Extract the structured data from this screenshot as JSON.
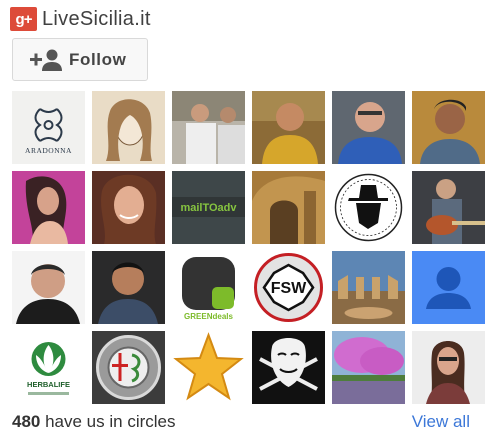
{
  "page": {
    "title": "LiveSicilia.it",
    "badge": "g+"
  },
  "follow": {
    "label": "Follow",
    "icon": "person-add-icon"
  },
  "avatars": [
    {
      "name": "avatar-aradonna",
      "label": "ARADONNA",
      "kind": "logo"
    },
    {
      "name": "avatar-illustration-woman",
      "kind": "photo"
    },
    {
      "name": "avatar-men-group",
      "kind": "photo"
    },
    {
      "name": "avatar-man-outdoor",
      "kind": "photo"
    },
    {
      "name": "avatar-man-blue-shirt",
      "kind": "photo"
    },
    {
      "name": "avatar-man-portrait",
      "kind": "photo"
    },
    {
      "name": "avatar-woman-pink",
      "kind": "photo"
    },
    {
      "name": "avatar-woman-smile",
      "kind": "photo"
    },
    {
      "name": "avatar-mailtoadv",
      "label": "mailTOadv",
      "kind": "logo"
    },
    {
      "name": "avatar-arch-building",
      "kind": "photo"
    },
    {
      "name": "avatar-hat-silhouette",
      "kind": "logo"
    },
    {
      "name": "avatar-guitarist",
      "kind": "photo"
    },
    {
      "name": "avatar-man-white-bg",
      "kind": "photo"
    },
    {
      "name": "avatar-man-dark",
      "kind": "photo"
    },
    {
      "name": "avatar-greendeals",
      "label": "GREENdeals",
      "kind": "logo"
    },
    {
      "name": "avatar-fsw",
      "label": "FSW",
      "kind": "logo"
    },
    {
      "name": "avatar-theatre",
      "kind": "photo"
    },
    {
      "name": "avatar-default-profile",
      "kind": "placeholder"
    },
    {
      "name": "avatar-herbalife",
      "label": "HERBALIFE",
      "kind": "logo"
    },
    {
      "name": "avatar-alfa-romeo",
      "kind": "logo"
    },
    {
      "name": "avatar-star",
      "kind": "logo"
    },
    {
      "name": "avatar-anonymous-mask",
      "kind": "logo"
    },
    {
      "name": "avatar-pink-tree",
      "kind": "photo"
    },
    {
      "name": "avatar-woman-sunglasses",
      "kind": "photo"
    }
  ],
  "footer": {
    "count": "480",
    "count_suffix": " have us in circles",
    "view_all": "View all"
  },
  "colors": {
    "gplus_red": "#dd4b39",
    "link_blue": "#3d78d8",
    "default_avatar": "#4a8af4"
  }
}
